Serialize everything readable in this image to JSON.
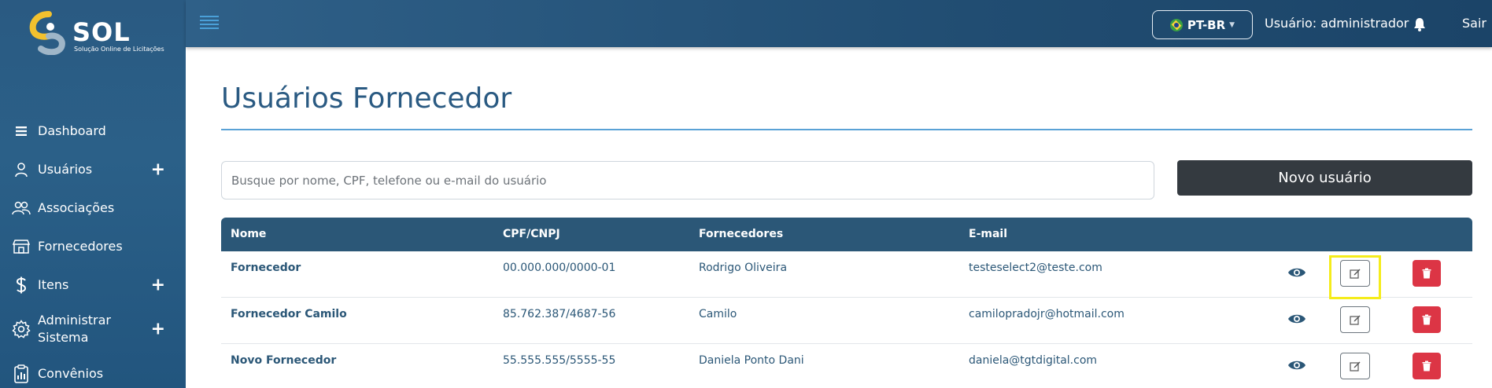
{
  "app": {
    "logo_title": "SOL",
    "logo_subtitle": "Solução Online de Licitações",
    "accent_color": "#2a5a82",
    "header_color": "#214d72",
    "danger_color": "#dc3545"
  },
  "header": {
    "language": "PT-BR",
    "user_label": "Usuário: administrador",
    "logout_label": "Sair",
    "icons": [
      "hamburger-icon",
      "brazil-flag-icon",
      "bell-icon"
    ]
  },
  "sidebar": {
    "items": [
      {
        "label": "Dashboard",
        "icon": "dashboard-icon",
        "expandable": false
      },
      {
        "label": "Usuários",
        "icon": "user-icon",
        "expandable": true
      },
      {
        "label": "Associações",
        "icon": "users-group-icon",
        "expandable": false
      },
      {
        "label": "Fornecedores",
        "icon": "store-icon",
        "expandable": false
      },
      {
        "label": "Itens",
        "icon": "dollar-icon",
        "expandable": true
      },
      {
        "label": "Administrar Sistema",
        "icon": "gear-icon",
        "expandable": true
      },
      {
        "label": "Convênios",
        "icon": "clipboard-chart-icon",
        "expandable": false
      }
    ],
    "plus_symbol": "+"
  },
  "main": {
    "title": "Usuários Fornecedor",
    "search_placeholder": "Busque por nome, CPF, telefone ou e-mail do usuário",
    "new_user_label": "Novo usuário",
    "table": {
      "headers": [
        "Nome",
        "CPF/CNPJ",
        "Fornecedores",
        "E-mail"
      ],
      "rows": [
        [
          "Fornecedor",
          "00.000.000/0000-01",
          "Rodrigo Oliveira",
          "testeselect2@teste.com"
        ],
        [
          "Fornecedor Camilo",
          "85.762.387/4687-56",
          "Camilo",
          "camilopradojr@hotmail.com"
        ],
        [
          "Novo Fornecedor",
          "55.555.555/5555-55",
          "Daniela Ponto Dani",
          "daniela@tgtdigital.com"
        ]
      ],
      "row_actions": [
        "eye-icon",
        "edit-icon",
        "trash-icon"
      ]
    }
  }
}
